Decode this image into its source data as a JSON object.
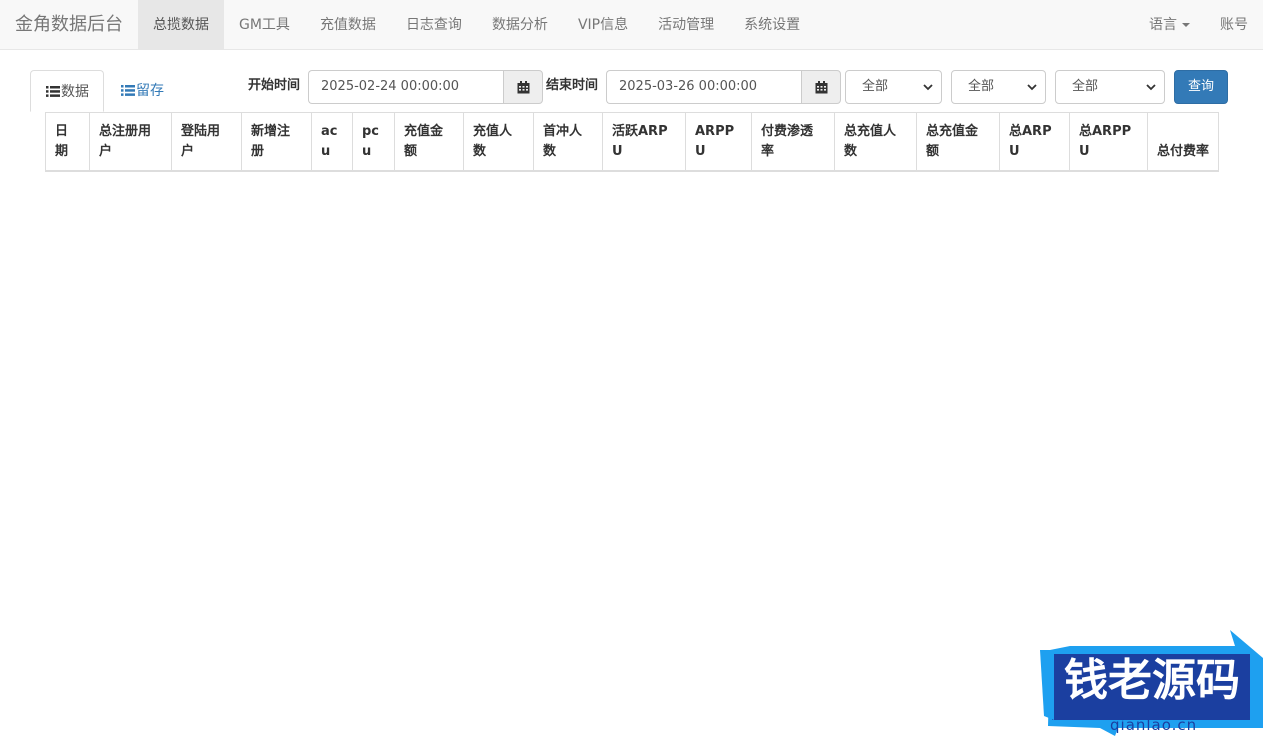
{
  "brand": "金角数据后台",
  "nav": [
    "总揽数据",
    "GM工具",
    "充值数据",
    "日志查询",
    "数据分析",
    "VIP信息",
    "活动管理",
    "系统设置"
  ],
  "nav_right": {
    "language": "语言",
    "account": "账号"
  },
  "tabs": {
    "data": "数据",
    "retention": "留存"
  },
  "filters": {
    "start_label": "开始时间",
    "start_value": "2025-02-24 00:00:00",
    "end_label": "结束时间",
    "end_value": "2025-03-26 00:00:00",
    "select1": "全部",
    "select2": "全部",
    "select3": "全部",
    "query_button": "查询"
  },
  "table": {
    "headers": [
      "日期",
      "总注册用户",
      "登陆用户",
      "新增注册",
      "acu",
      "pcu",
      "充值金额",
      "充值人数",
      "首冲人数",
      "活跃ARPU",
      "ARPPU",
      "付费渗透率",
      "总充值人数",
      "总充值金额",
      "总ARPU",
      "总ARPPU",
      "总付费率"
    ]
  },
  "watermark": {
    "title": "钱老源码",
    "url": "qianlao.cn"
  },
  "colors": {
    "primary": "#337ab7",
    "watermark_blue": "#1b3fa0",
    "watermark_accent": "#1ea0f0"
  }
}
